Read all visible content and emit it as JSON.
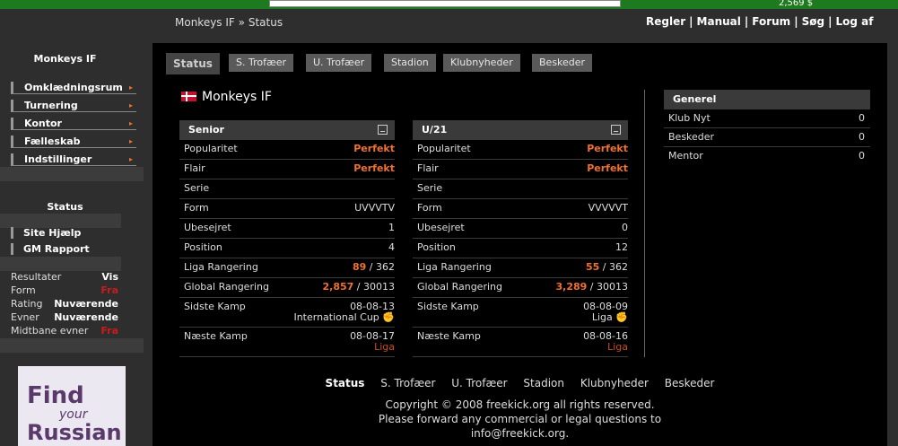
{
  "header": {
    "money": "2,569 $",
    "breadcrumb": [
      "Monkeys IF",
      "»",
      "Status"
    ],
    "toplinks": [
      "Regler",
      "Manual",
      "Forum",
      "Søg",
      "Log af"
    ],
    "sep": "|"
  },
  "sidebar": {
    "club_title": "Monkeys IF",
    "menu": [
      {
        "label": "Omklædningsrum"
      },
      {
        "label": "Turnering"
      },
      {
        "label": "Kontor"
      },
      {
        "label": "Fælleskab"
      },
      {
        "label": "Indstillinger"
      }
    ],
    "arrow": "▸",
    "status_title": "Status",
    "links": [
      "Site Hjælp",
      "GM Rapport"
    ],
    "stats": [
      {
        "label": "Resultater",
        "value": "Vis",
        "red": false
      },
      {
        "label": "Form",
        "value": "Fra",
        "red": true
      },
      {
        "label": "Rating",
        "value": "Nuværende",
        "red": false
      },
      {
        "label": "Evner",
        "value": "Nuværende",
        "red": false
      },
      {
        "label": "Midtbane evner",
        "value": "Fra",
        "red": true
      }
    ],
    "ad": [
      "Find",
      "your",
      "Russian"
    ]
  },
  "tabs": [
    "Status",
    "S. Trofæer",
    "U. Trofæer",
    "Stadion",
    "Klubnyheder",
    "Beskeder"
  ],
  "team_name": "Monkeys IF",
  "senior": {
    "title": "Senior",
    "popularitet": "Perfekt",
    "flair": "Perfekt",
    "serie": "",
    "form": "UVVVTV",
    "ubesejret": "1",
    "position": "4",
    "liga_rank": "89",
    "liga_total": "/ 362",
    "global_rank": "2,857",
    "global_total": "/ 30013",
    "sidste_date": "08-08-13",
    "sidste_comp": "International Cup",
    "naeste_date": "08-08-17",
    "naeste_comp": "Liga"
  },
  "u21": {
    "title": "U/21",
    "popularitet": "Perfekt",
    "flair": "Perfekt",
    "serie": "",
    "form": "VVVVVT",
    "ubesejret": "0",
    "position": "12",
    "liga_rank": "55",
    "liga_total": "/ 362",
    "global_rank": "3,289",
    "global_total": "/ 30013",
    "sidste_date": "08-08-09",
    "sidste_comp": "Liga",
    "naeste_date": "08-08-16",
    "naeste_comp": "Liga"
  },
  "labels": {
    "popularitet": "Popularitet",
    "flair": "Flair",
    "serie": "Serie",
    "form": "Form",
    "ubesejret": "Ubesejret",
    "position": "Position",
    "liga": "Liga Rangering",
    "global": "Global Rangering",
    "sidste": "Sidste Kamp",
    "naeste": "Næste Kamp"
  },
  "generel": {
    "title": "Generel",
    "rows": [
      {
        "label": "Klub Nyt",
        "value": "0"
      },
      {
        "label": "Beskeder",
        "value": "0"
      },
      {
        "label": "Mentor",
        "value": "0"
      }
    ]
  },
  "footer": {
    "links": [
      "Status",
      "S. Trofæer",
      "U. Trofæer",
      "Stadion",
      "Klubnyheder",
      "Beskeder"
    ],
    "line1": "Copyright © 2008 freekick.org all rights reserved.",
    "line2": "Please forward any commercial or legal questions to",
    "line3": "info@freekick.org."
  }
}
